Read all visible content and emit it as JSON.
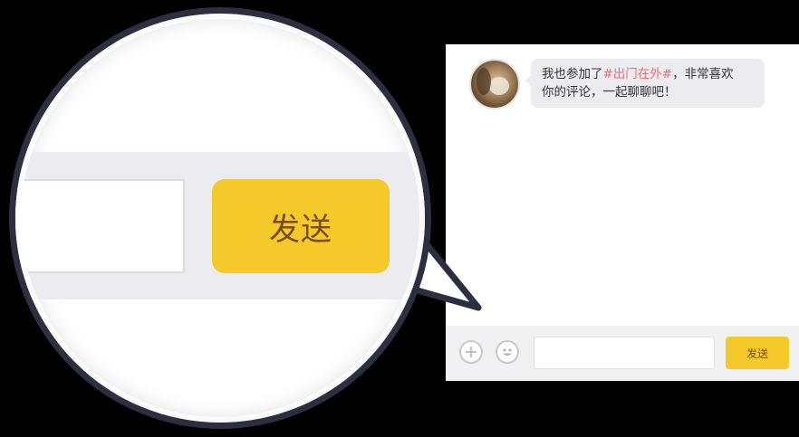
{
  "chat": {
    "message": {
      "prefix": "我也参加了",
      "topic": "#出门在外#",
      "line1_suffix": "，非常喜欢",
      "line2": "你的评论，一起聊聊吧！"
    },
    "input": {
      "value": "",
      "placeholder": ""
    },
    "send_label": "发送",
    "icons": {
      "plus": "plus-icon",
      "emoji": "smiley-icon"
    }
  },
  "magnifier": {
    "send_label": "发送"
  },
  "colors": {
    "send_button": "#f5c92a",
    "send_text": "#7a4a0e",
    "topic": "#f06a6a",
    "lens_rim": "#2c2f3f",
    "bubble": "#ececf0"
  }
}
